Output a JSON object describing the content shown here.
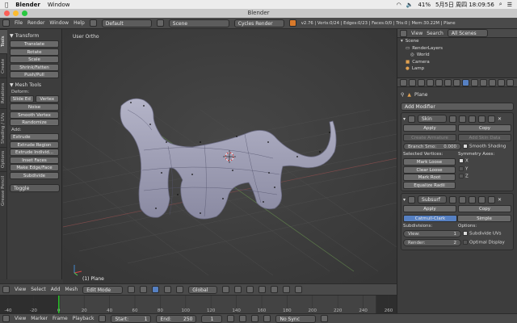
{
  "menubar": {
    "app": "Blender",
    "window": "Window",
    "battery": "41%",
    "datetime": "5月5日 周四 18:09:56"
  },
  "window": {
    "title": "Blender"
  },
  "info_header": {
    "menus": [
      "File",
      "Render",
      "Window",
      "Help"
    ],
    "layout": "Default",
    "scene": "Scene",
    "engine": "Cycles Render",
    "stats": "v2.76 | Verts:0/24 | Edges:0/23 | Faces:0/0 | Tris:0 | Mem:30.22M | Plane"
  },
  "tabs": [
    "Tools",
    "Create",
    "Relations",
    "Shading / UVs",
    "Options",
    "Grease Pencil"
  ],
  "tools": {
    "transform_title": "▼ Transform",
    "transform": [
      "Translate",
      "Rotate",
      "Scale",
      "Shrink/Fatten",
      "Push/Pull"
    ],
    "mesh_tools_title": "▼ Mesh Tools",
    "deform_label": "Deform:",
    "slide_edge": "Slide Ed",
    "vertex": "Vertex",
    "deform": [
      "Noise",
      "Smooth Vertex",
      "Randomize"
    ],
    "add_label": "Add:",
    "extrude": "Extrude",
    "add": [
      "Extrude Region",
      "Extrude Individ...",
      "Inset Faces",
      "Make Edge/Face",
      "Subdivide"
    ],
    "toggle": "Toggle"
  },
  "viewport": {
    "view_label": "User Ortho",
    "object_label": "(1) Plane"
  },
  "view3d_header": {
    "menus": [
      "View",
      "Select",
      "Add",
      "Mesh"
    ],
    "mode": "Edit Mode",
    "pivot": "Global"
  },
  "timeline": {
    "ticks": [
      "-40",
      "-20",
      "0",
      "20",
      "40",
      "60",
      "80",
      "100",
      "120",
      "140",
      "160",
      "180",
      "200",
      "220",
      "240",
      "260"
    ],
    "current_frame": 0,
    "frame_start": 1,
    "frame_end": 250,
    "range_min": -40,
    "range_max": 260
  },
  "timeline_header": {
    "menus": [
      "View",
      "Marker",
      "Frame",
      "Playback"
    ],
    "start": "Start:",
    "start_val": "1",
    "end": "End:",
    "end_val": "250",
    "current": "1",
    "sync": "No Sync"
  },
  "outliner": {
    "view": "View",
    "search": "Search",
    "scope": "All Scenes",
    "items": [
      "Scene",
      "RenderLayers",
      "World",
      "Camera",
      "Lamp"
    ]
  },
  "properties": {
    "object": "Plane",
    "add_modifier": "Add Modifier",
    "skin": {
      "name": "Skin",
      "apply": "Apply",
      "copy": "Copy",
      "create_armature": "Create Armature",
      "add_skin_data": "Add Skin Data",
      "branch_label": "Branch Smo:",
      "branch_val": "0.000",
      "smooth_shading": "Smooth Shading",
      "selected_vertices": "Selected Vertices:",
      "symmetry_axes": "Symmetry Axes:",
      "mark_loose": "Mark Loose",
      "clear_loose": "Clear Loose",
      "mark_root": "Mark Root",
      "equalize": "Equalize Radii",
      "x": "X",
      "y": "Y",
      "z": "Z"
    },
    "subsurf": {
      "name": "Subsurf",
      "apply": "Apply",
      "copy": "Copy",
      "catmull": "Catmull-Clark",
      "simple": "Simple",
      "subdivisions": "Subdivisions:",
      "options": "Options:",
      "view_label": "View:",
      "view_val": "1",
      "render_label": "Render:",
      "render_val": "2",
      "subdivide_uvs": "Subdivide UVs",
      "optimal_display": "Optimal Display"
    }
  },
  "colors": {
    "accent": "#5680c2",
    "frame_bar": "#29c229"
  }
}
